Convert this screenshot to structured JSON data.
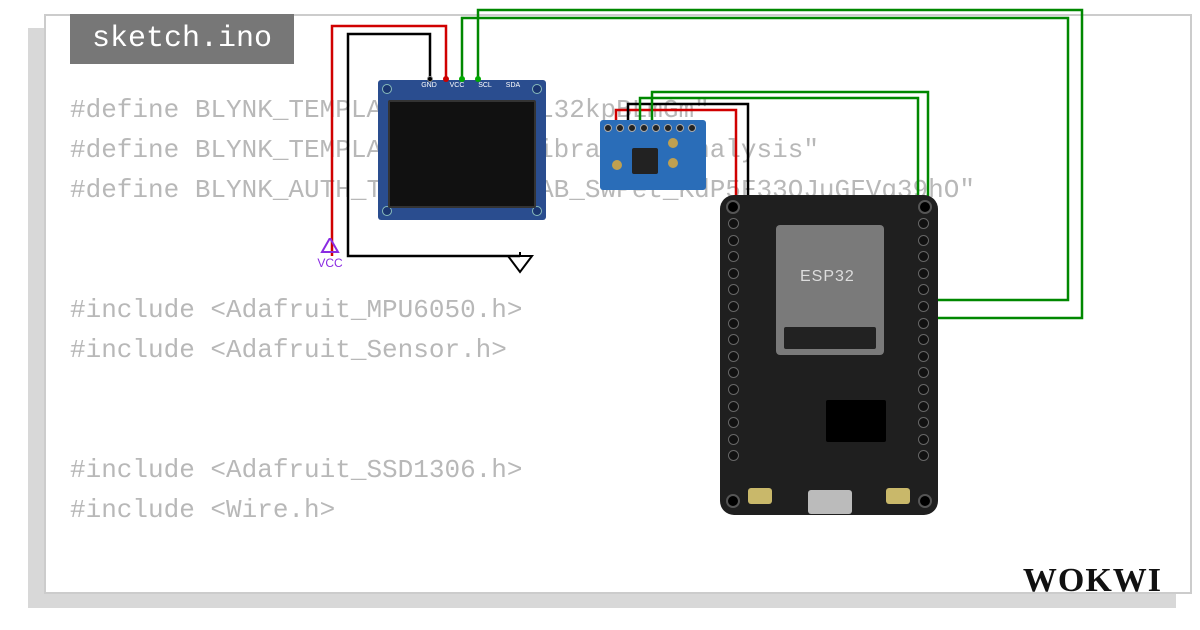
{
  "filename": "sketch.ino",
  "logo": "WOKWI",
  "code_lines": [
    "#define BLYNK_TEMPLATE_ID \"TMPL32kpBLmGm\"",
    "#define BLYNK_TEMPLATE_NAME \"Vibration Analysis\"",
    "#define BLYNK_AUTH_TOKEN \"qRjbAB_SwPet_KdP5F33OJuGFVg39hO\"",
    "",
    "",
    "#include <Adafruit_MPU6050.h>",
    "#include <Adafruit_Sensor.h>",
    "",
    "",
    "#include <Adafruit_SSD1306.h>",
    "#include <Wire.h>"
  ],
  "oled": {
    "pin_labels": [
      "GND",
      "VCC",
      "SCL",
      "SDA"
    ]
  },
  "esp32": {
    "label": "ESP32"
  },
  "symbols": {
    "vcc": "VCC"
  },
  "components": {
    "oled_name": "ssd1306-oled-display",
    "mpu_name": "mpu6050-module",
    "esp_name": "esp32-devkit",
    "vcc_name": "vcc-symbol",
    "gnd_name": "gnd-symbol"
  },
  "wires": [
    {
      "name": "oled-vcc-to-vcc",
      "color": "#d00000"
    },
    {
      "name": "oled-gnd-to-gnd",
      "color": "#000000"
    },
    {
      "name": "oled-scl-to-esp",
      "color": "#008800"
    },
    {
      "name": "oled-sda-to-esp",
      "color": "#008800"
    },
    {
      "name": "mpu-vcc-to-esp",
      "color": "#d00000"
    },
    {
      "name": "mpu-gnd-to-esp",
      "color": "#000000"
    },
    {
      "name": "mpu-scl-to-esp",
      "color": "#008800"
    },
    {
      "name": "mpu-sda-to-esp",
      "color": "#008800"
    }
  ]
}
